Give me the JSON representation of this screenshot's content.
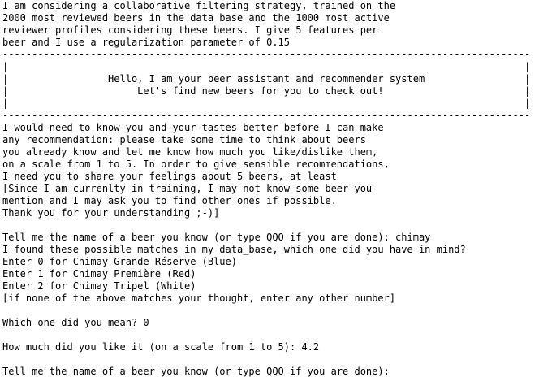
{
  "intro": {
    "line1": "I am considering a collaborative filtering strategy, trained on the",
    "line2": "2000 most reviewed beers in the data base and the 1000 most active",
    "line3": "reviewer profiles considering these beers. I give 5 features per",
    "line4": "beer and I use a regularization parameter of 0.15"
  },
  "banner": {
    "top_rule": "------------------------------------------------------------------------------------------",
    "empty_row": "|                                                                                        |",
    "greeting_row": "|                 Hello, I am your beer assistant and recommender system                 |",
    "subtitle_row": "|                      Let's find new beers for you to check out!                        |",
    "empty_row_2": "|                                                                                        |",
    "bottom_rule": "------------------------------------------------------------------------------------------"
  },
  "explanation": {
    "line1": "I would need to know you and your tastes better before I can make",
    "line2": "any recommendation: please take some time to think about beers",
    "line3": "you already know and let me know how much you like/dislike them,",
    "line4": "on a scale from 1 to 5. In order to give sensible recommendations,",
    "line5": "I need you to share your feelings about 5 beers, at least",
    "line6": "[Since I am currenlty in training, I may not know some beer you",
    "line7": "mention and I may ask you to find other ones if possible.",
    "line8": "Thank you for your understanding ;-)]"
  },
  "session": {
    "prompt_name_1": "Tell me the name of a beer you know (or type QQQ if you are done): chimay",
    "matches_header": "I found these possible matches in my data_base, which one did you have in mind?",
    "option_0": "Enter 0 for Chimay Grande Réserve (Blue)",
    "option_1": "Enter 1 for Chimay Première (Red)",
    "option_2": "Enter 2 for Chimay Tripel (White)",
    "none_option": "[if none of the above matches your thought, enter any other number]",
    "which_prompt": "Which one did you mean? 0",
    "rating_prompt": "How much did you like it (on a scale from 1 to 5): 4.2",
    "prompt_name_2": "Tell me the name of a beer you know (or type QQQ if you are done): "
  }
}
